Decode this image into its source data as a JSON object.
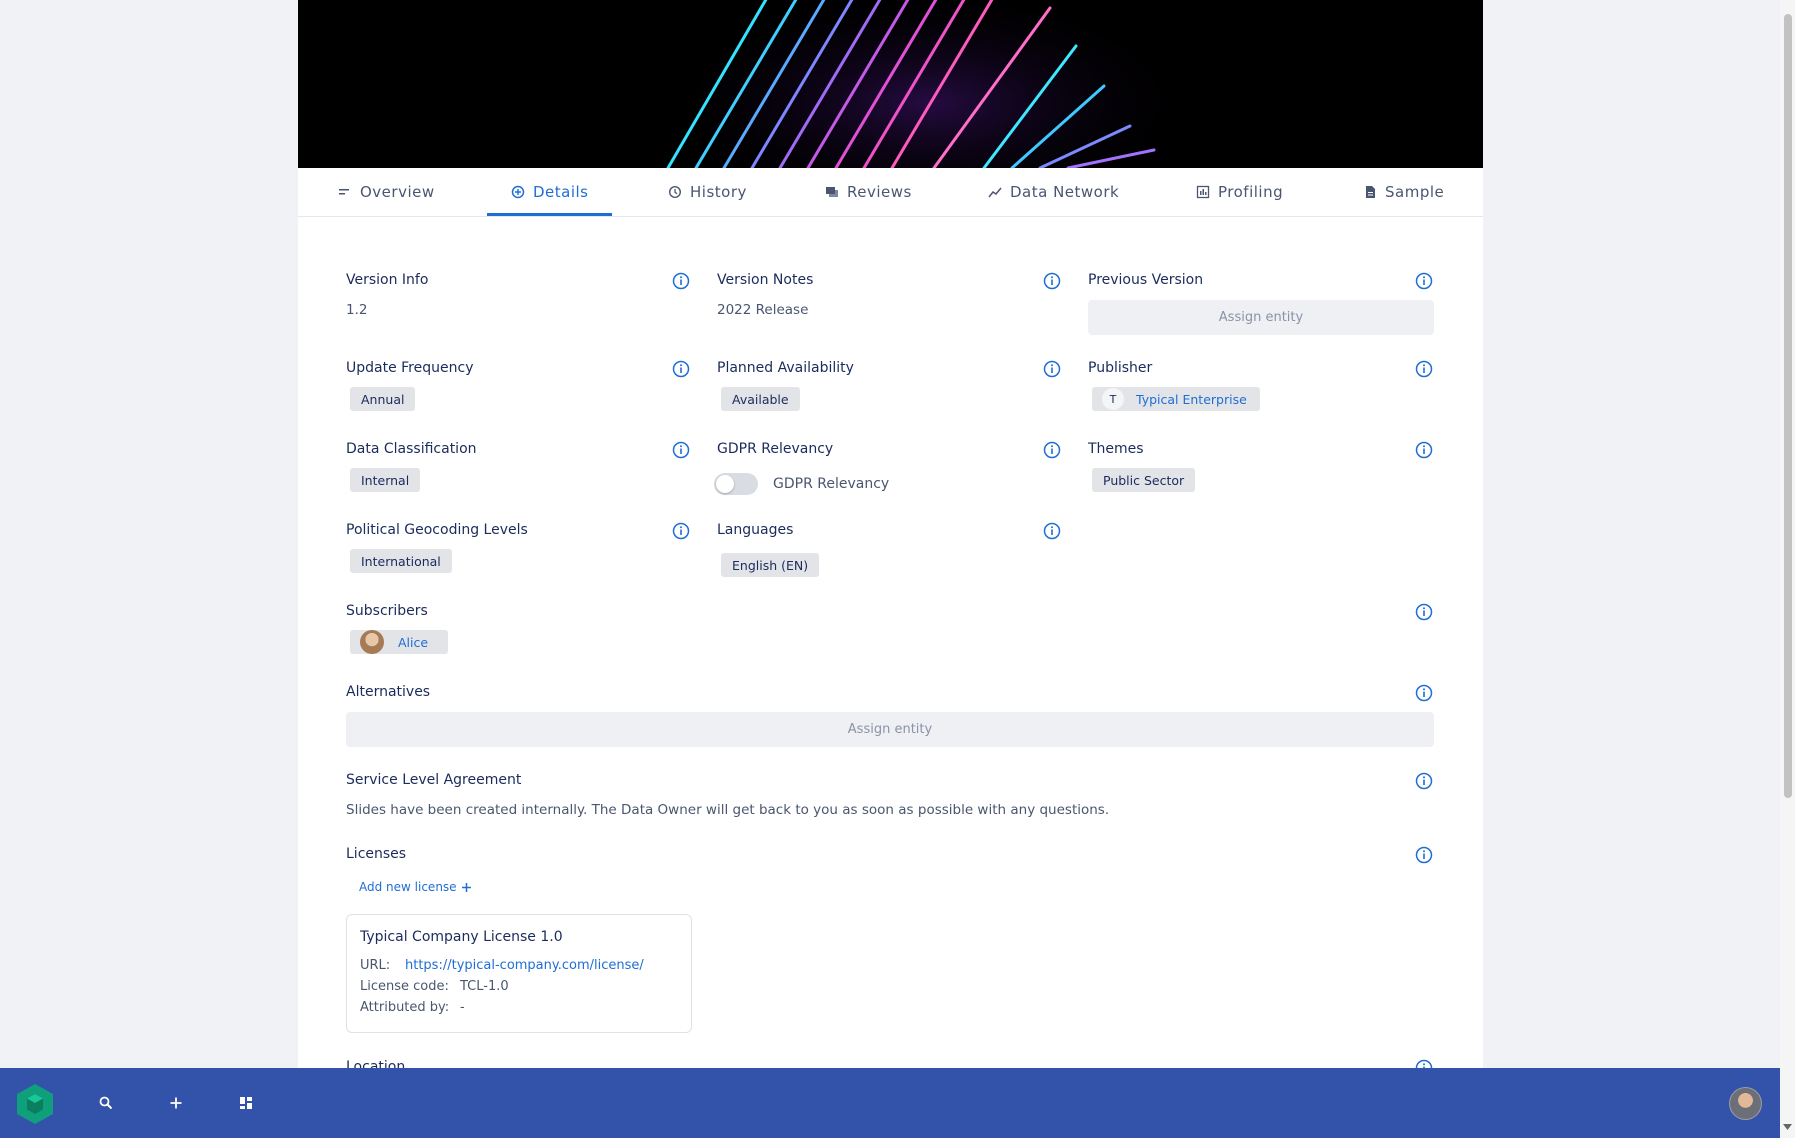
{
  "tabs": [
    {
      "label": "Overview",
      "icon": "overview-icon",
      "active": false
    },
    {
      "label": "Details",
      "icon": "details-icon",
      "active": true
    },
    {
      "label": "History",
      "icon": "history-icon",
      "active": false
    },
    {
      "label": "Reviews",
      "icon": "reviews-icon",
      "active": false
    },
    {
      "label": "Data Network",
      "icon": "data-network-icon",
      "active": false
    },
    {
      "label": "Profiling",
      "icon": "profiling-icon",
      "active": false
    },
    {
      "label": "Sample",
      "icon": "sample-icon",
      "active": false
    }
  ],
  "fields": {
    "version_info": {
      "label": "Version Info",
      "value": "1.2"
    },
    "version_notes": {
      "label": "Version Notes",
      "value": "2022 Release"
    },
    "previous_version": {
      "label": "Previous Version",
      "placeholder": "Assign entity"
    },
    "update_frequency": {
      "label": "Update Frequency",
      "value": "Annual"
    },
    "planned_availability": {
      "label": "Planned Availability",
      "value": "Available"
    },
    "publisher": {
      "label": "Publisher",
      "initial": "T",
      "value": "Typical Enterprise"
    },
    "data_classification": {
      "label": "Data Classification",
      "value": "Internal"
    },
    "gdpr_relevancy": {
      "label": "GDPR Relevancy",
      "toggle_label": "GDPR Relevancy",
      "enabled": false
    },
    "themes": {
      "label": "Themes",
      "value": "Public Sector"
    },
    "political_geocoding": {
      "label": "Political Geocoding Levels",
      "value": "International"
    },
    "languages": {
      "label": "Languages",
      "value": "English (EN)"
    },
    "subscribers": {
      "label": "Subscribers",
      "value": "Alice"
    },
    "alternatives": {
      "label": "Alternatives",
      "placeholder": "Assign entity"
    },
    "sla": {
      "label": "Service Level Agreement",
      "value": "Slides have been created internally. The Data Owner will get back to you as soon as possible with any questions."
    },
    "licenses": {
      "label": "Licenses",
      "add_label": "Add new license"
    },
    "location": {
      "label": "Location"
    }
  },
  "license": {
    "title": "Typical Company License 1.0",
    "url_label": "URL:",
    "url": "https://typical-company.com/license/",
    "code_label": "License code:",
    "code": "TCL-1.0",
    "attributed_label": "Attributed by:",
    "attributed": "-"
  },
  "colors": {
    "accent": "#1f6ed4",
    "bottom_bar": "#3352a9",
    "logo": "#0f9f7a"
  }
}
